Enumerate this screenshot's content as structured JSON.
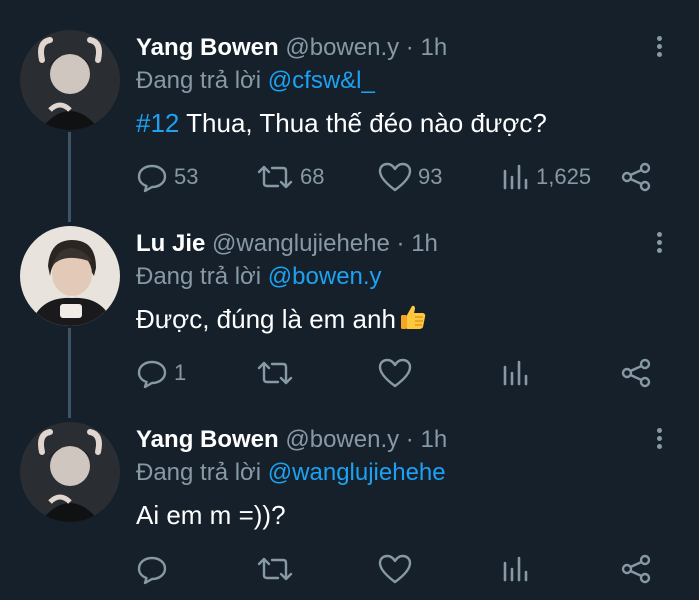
{
  "tweets": [
    {
      "author": "Yang Bowen",
      "handle": "@bowen.y",
      "separator": "·",
      "time": "1h",
      "reply_prefix": "Đang trả lời",
      "reply_to": "@cfsw&l_",
      "hashtag": "#12",
      "text": " Thua, Thua thế đéo nào được?",
      "replies": "53",
      "retweets": "68",
      "likes": "93",
      "views": "1,625"
    },
    {
      "author": "Lu Jie",
      "handle": "@wanglujiehehe",
      "separator": "·",
      "time": "1h",
      "reply_prefix": "Đang trả lời",
      "reply_to": "@bowen.y",
      "text": "Được, đúng là em anh",
      "emoji": "thumbs-up-icon",
      "replies": "1"
    },
    {
      "author": "Yang Bowen",
      "handle": "@bowen.y",
      "separator": "·",
      "time": "1h",
      "reply_prefix": "Đang trả lời",
      "reply_to": "@wanglujiehehe",
      "text": "Ai em m =))?"
    }
  ],
  "colors": {
    "background": "#15202b",
    "text": "#ffffff",
    "muted": "#8899a6",
    "accent": "#1da1f2",
    "thread_line": "#3d5466"
  },
  "icons": {
    "more": "more-vertical-icon",
    "reply": "reply-icon",
    "retweet": "retweet-icon",
    "like": "heart-icon",
    "views": "analytics-icon",
    "share": "share-icon"
  }
}
